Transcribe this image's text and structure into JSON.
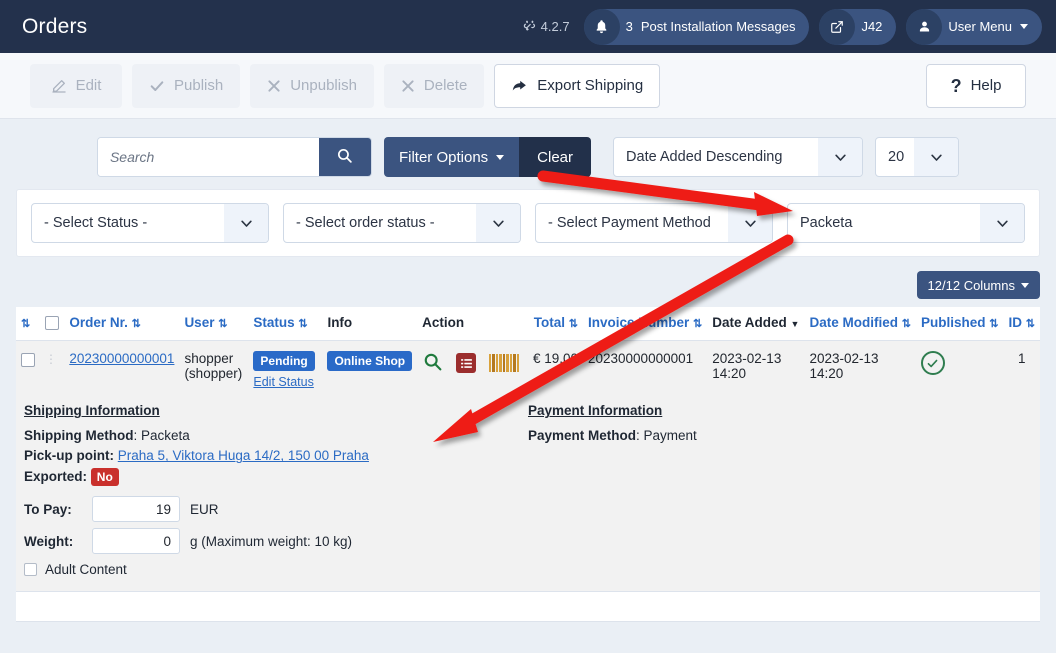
{
  "header": {
    "title": "Orders",
    "version_label": "4.2.7",
    "joomla_icon": "joomla-logo-icon",
    "notifications": {
      "icon": "bell-icon",
      "count": "3",
      "label": "Post Installation Messages"
    },
    "preview": {
      "icon": "external-link-icon",
      "label": "J42"
    },
    "user_menu": {
      "icon": "user-circle-icon",
      "label": "User Menu"
    }
  },
  "toolbar": {
    "buttons": [
      {
        "label": "Edit",
        "icon": "pencil-square-icon",
        "enabled": false
      },
      {
        "label": "Publish",
        "icon": "check-icon",
        "enabled": false
      },
      {
        "label": "Unpublish",
        "icon": "times-icon",
        "enabled": false
      },
      {
        "label": "Delete",
        "icon": "times-icon",
        "enabled": false
      },
      {
        "label": "Export Shipping",
        "icon": "share-arrow-icon",
        "enabled": true
      }
    ],
    "help": {
      "label": "Help",
      "icon": "question-mark-icon"
    }
  },
  "search": {
    "placeholder": "Search",
    "value": "",
    "search_icon": "magnifier-icon",
    "filter_options_label": "Filter Options",
    "clear_label": "Clear",
    "sort_value": "Date Added Descending",
    "limit_value": "20"
  },
  "filters": [
    {
      "name": "status",
      "value": "- Select Status -"
    },
    {
      "name": "order-status",
      "value": "- Select order status -"
    },
    {
      "name": "payment-method",
      "value": "- Select Payment Method"
    },
    {
      "name": "shipment-method",
      "value": "Packeta"
    }
  ],
  "columns_button": {
    "label": "12/12 Columns"
  },
  "table": {
    "headers": [
      {
        "key": "ordering",
        "label": "",
        "sortable": true,
        "style": "blue"
      },
      {
        "key": "checkall",
        "label": "",
        "sortable": false,
        "style": "blue"
      },
      {
        "key": "order_nr",
        "label": "Order Nr.",
        "sortable": true,
        "style": "blue"
      },
      {
        "key": "user",
        "label": "User",
        "sortable": true,
        "style": "blue"
      },
      {
        "key": "status",
        "label": "Status",
        "sortable": true,
        "style": "blue"
      },
      {
        "key": "info",
        "label": "Info",
        "sortable": false,
        "style": "dark"
      },
      {
        "key": "action",
        "label": "Action",
        "sortable": false,
        "style": "dark"
      },
      {
        "key": "total",
        "label": "Total",
        "sortable": true,
        "style": "blue"
      },
      {
        "key": "invoice_number",
        "label": "Invoice Number",
        "sortable": true,
        "style": "blue"
      },
      {
        "key": "date_added",
        "label": "Date Added",
        "sortable": "desc",
        "style": "dark"
      },
      {
        "key": "date_modified",
        "label": "Date Modified",
        "sortable": true,
        "style": "blue"
      },
      {
        "key": "published",
        "label": "Published",
        "sortable": true,
        "style": "blue"
      },
      {
        "key": "id",
        "label": "ID",
        "sortable": true,
        "style": "blue"
      }
    ],
    "rows": [
      {
        "order_nr": "20230000000001",
        "user_name": "shopper",
        "user_alias": "(shopper)",
        "status_badge": "Pending",
        "edit_status_label": "Edit Status",
        "info_badge": "Online Shop",
        "actions": [
          "search-icon",
          "order-list-icon",
          "barcode-icon"
        ],
        "total": "€ 19,00",
        "invoice_number": "20230000000001",
        "date_added": "2023-02-13 14:20",
        "date_added_date": "2023-02-13",
        "date_added_time": "14:20",
        "date_modified_date": "2023-02-13",
        "date_modified_time": "14:20",
        "published_icon": "check-circle-icon",
        "id": "1"
      }
    ]
  },
  "detail": {
    "shipping": {
      "heading": "Shipping Information",
      "method_label": "Shipping Method",
      "method_value": "Packeta",
      "pickup_label": "Pick-up point:",
      "pickup_value": "Praha 5, Viktora Huga 14/2, 150 00 Praha",
      "exported_label": "Exported:",
      "exported_value": "No",
      "topay_label": "To Pay:",
      "topay_value": "19",
      "topay_unit": "EUR",
      "weight_label": "Weight:",
      "weight_value": "0",
      "weight_unit": "g (Maximum weight: 10 kg)",
      "adult_label": "Adult Content"
    },
    "payment": {
      "heading": "Payment Information",
      "method_label": "Payment Method",
      "method_value": "Payment"
    }
  },
  "annotations": {
    "arrow_color": "#ee1c16",
    "arrows": [
      {
        "name": "arrow-to-shipment-filter",
        "from": [
          543,
          175
        ],
        "to": [
          789,
          210
        ]
      },
      {
        "name": "arrow-to-shipping-details",
        "from": [
          790,
          240
        ],
        "to": [
          433,
          440
        ]
      }
    ]
  },
  "colors": {
    "header_bg": "#23314c",
    "accent_blue": "#3b5480",
    "badge_blue": "#2a6ac8",
    "link_blue": "#2b6bc4",
    "danger_red": "#c9302c",
    "success_green": "#2f7d4f",
    "page_bg": "#eaeff5"
  }
}
